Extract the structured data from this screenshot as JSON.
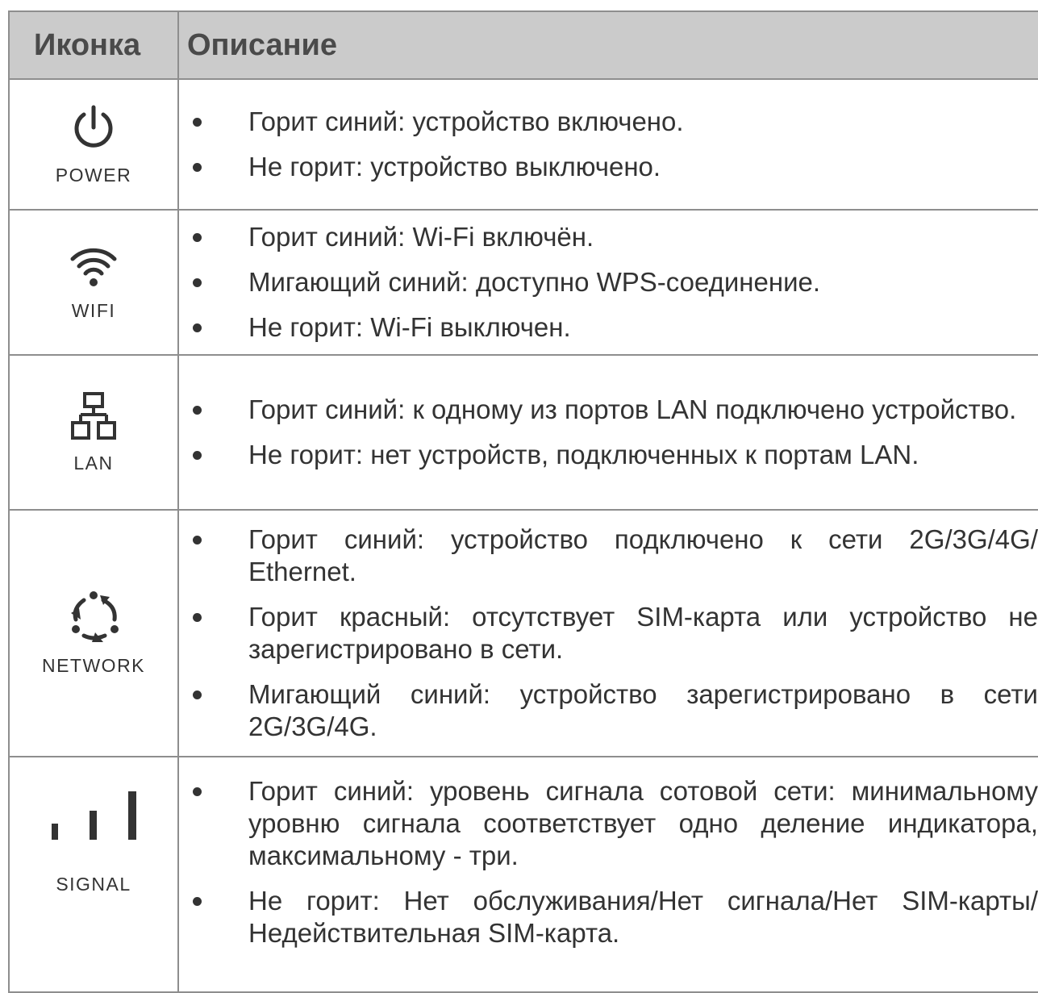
{
  "header": {
    "icon_col": "Иконка",
    "desc_col": "Описание"
  },
  "rows": [
    {
      "icon": "power-icon",
      "label": "POWER",
      "items": [
        "Горит синий: устройство включено.",
        "Не горит: устройство выключено."
      ]
    },
    {
      "icon": "wifi-icon",
      "label": "WIFI",
      "items": [
        "Горит синий: Wi-Fi включён.",
        "Мигающий синий: доступно WPS-соединение.",
        "Не горит: Wi-Fi выключен."
      ]
    },
    {
      "icon": "lan-icon",
      "label": "LAN",
      "items": [
        "Горит синий: к одному из портов LAN подключено устройство.",
        "Не горит: нет устройств, подключенных к портам LAN."
      ]
    },
    {
      "icon": "network-icon",
      "label": "NETWORK",
      "items": [
        "Горит синий: устройство подключено к сети 2G/3G/4G/ Ethernet.",
        "Горит красный: отсутствует SIM-карта или устройство не зарегистрировано в сети.",
        "Мигающий синий: устройство зарегистрировано в сети 2G/3G/4G."
      ]
    },
    {
      "icon": "signal-icon",
      "label": "SIGNAL",
      "items": [
        "Горит синий: уровень сигнала сотовой сети: минимальному уровню сигнала соответствует одно деление индикатора, максимальному - три.",
        "Не горит: Нет обслуживания/Нет сигнала/Нет SIM-карты/Недействительная SIM-карта."
      ]
    }
  ]
}
